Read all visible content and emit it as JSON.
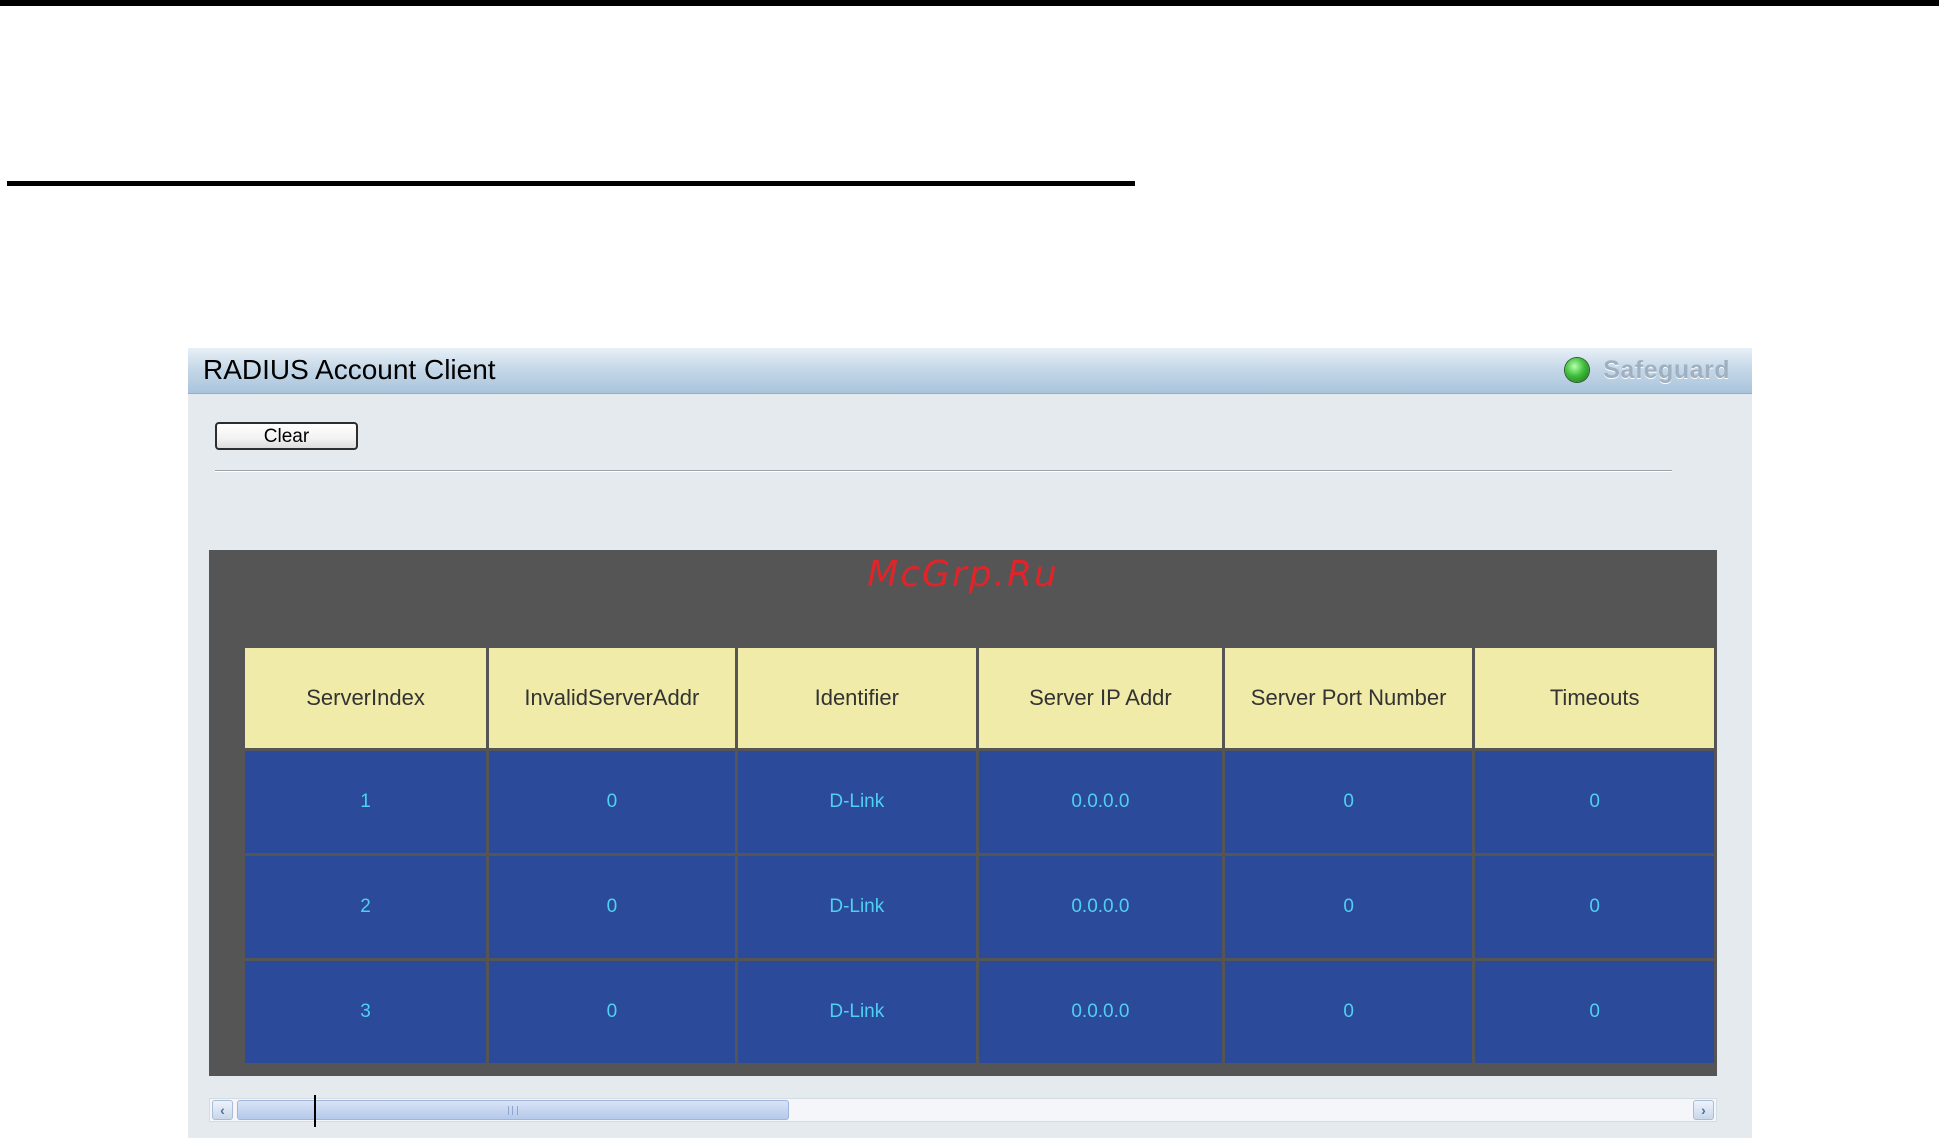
{
  "panel": {
    "title": "RADIUS Account Client",
    "safeguard_label": "Safeguard",
    "clear_label": "Clear"
  },
  "watermark": "McGrp.Ru",
  "table": {
    "headers": [
      "ServerIndex",
      "InvalidServerAddr",
      "Identifier",
      "Server IP Addr",
      "Server Port Number",
      "Timeouts"
    ],
    "rows": [
      [
        "1",
        "0",
        "D-Link",
        "0.0.0.0",
        "0",
        "0"
      ],
      [
        "2",
        "0",
        "D-Link",
        "0.0.0.0",
        "0",
        "0"
      ],
      [
        "3",
        "0",
        "D-Link",
        "0.0.0.0",
        "0",
        "0"
      ]
    ]
  },
  "icons": {
    "safeguard": "status-led-icon",
    "scroll_left": "chevron-left-icon",
    "scroll_right": "chevron-right-icon"
  },
  "colors": {
    "header_cell": "#f0eba8",
    "data_cell": "#2b4a9a",
    "data_text": "#4fd0f2",
    "frame": "#555555",
    "safeguard_led": "#3fbf3a"
  }
}
